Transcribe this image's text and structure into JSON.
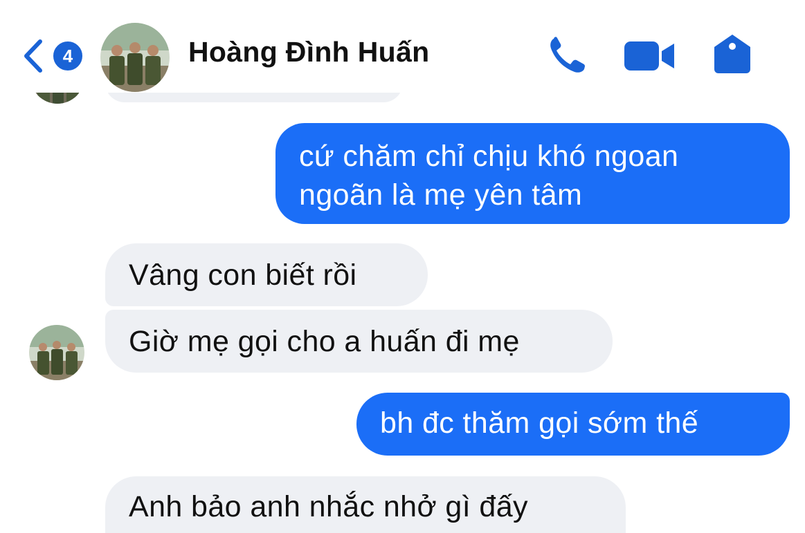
{
  "header": {
    "back_count": "4",
    "contact_name": "Hoàng Đình Huấn",
    "icons": [
      "back-chevron-icon",
      "phone-icon",
      "video-camera-icon",
      "tag-icon"
    ],
    "accent_color": "#1a63d6"
  },
  "messages": [
    {
      "side": "out",
      "lines": [
        "cứ chăm chỉ chịu khó ngoan",
        "ngoãn là mẹ yên tâm"
      ]
    },
    {
      "side": "in",
      "text": "Vâng con biết rồi"
    },
    {
      "side": "in",
      "text": "Giờ mẹ gọi cho a huấn đi mẹ"
    },
    {
      "side": "out",
      "text": "bh đc thăm gọi sớm thế"
    },
    {
      "side": "in",
      "text": "Anh bảo anh nhắc nhở gì đấy"
    }
  ],
  "colors": {
    "outgoing_bubble": "#1b6ef7",
    "incoming_bubble": "#eef0f4"
  }
}
